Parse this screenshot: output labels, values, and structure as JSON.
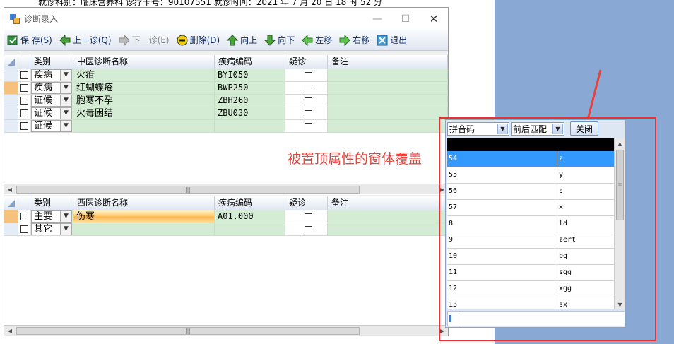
{
  "background_text": "就诊科别：临床营养科  诊疗卡号：90107551  就诊时间：2021 年 7 月 20 日 18 时 52 分",
  "window": {
    "title": "诊断录入",
    "minimize": "—",
    "maximize": "☐",
    "close": "✕"
  },
  "toolbar": {
    "save": "保 存(S)",
    "prev": "上一诊(Q)",
    "next": "下一诊(E)",
    "delete": "删除(D)",
    "up": "向上",
    "down": "向下",
    "left": "左移",
    "right": "右移",
    "exit": "退出"
  },
  "tcm_grid": {
    "headers": {
      "type": "类别",
      "name": "中医诊断名称",
      "code": "疾病编码",
      "doubt": "疑诊",
      "note": "备注"
    },
    "rows": [
      {
        "type": "疾病",
        "name": "火疳",
        "code": "BYI050"
      },
      {
        "type": "疾病",
        "name": "红蝴蝶疮",
        "code": "BWP250"
      },
      {
        "type": "证候",
        "name": "胞寒不孕",
        "code": "ZBH260"
      },
      {
        "type": "证候",
        "name": "火毒困结",
        "code": "ZBU030"
      },
      {
        "type": "证候",
        "name": "",
        "code": ""
      }
    ]
  },
  "wm_grid": {
    "headers": {
      "type": "类别",
      "name": "西医诊断名称",
      "code": "疾病编码",
      "doubt": "疑诊",
      "note": "备注"
    },
    "rows": [
      {
        "type": "主要",
        "name": "伤寒",
        "code": "A01.000"
      },
      {
        "type": "其它",
        "name": "",
        "code": ""
      }
    ]
  },
  "annotation": "被置顶属性的窗体覆盖",
  "popup": {
    "search_mode": "拼音码",
    "match_mode": "前后匹配",
    "close_label": "关闭",
    "rows": [
      {
        "k": "54",
        "v": "z"
      },
      {
        "k": "55",
        "v": "y"
      },
      {
        "k": "56",
        "v": "s"
      },
      {
        "k": "57",
        "v": "x"
      },
      {
        "k": "8",
        "v": "ld"
      },
      {
        "k": "9",
        "v": "zert"
      },
      {
        "k": "10",
        "v": "bg"
      },
      {
        "k": "11",
        "v": "sgg"
      },
      {
        "k": "12",
        "v": "xgg"
      },
      {
        "k": "13",
        "v": "sx"
      }
    ],
    "selected_index": 0
  },
  "colors": {
    "annotation": "#e8423b",
    "frame": "#ea3030",
    "selection": "#3399ff",
    "row_green": "#d4ecd3"
  }
}
